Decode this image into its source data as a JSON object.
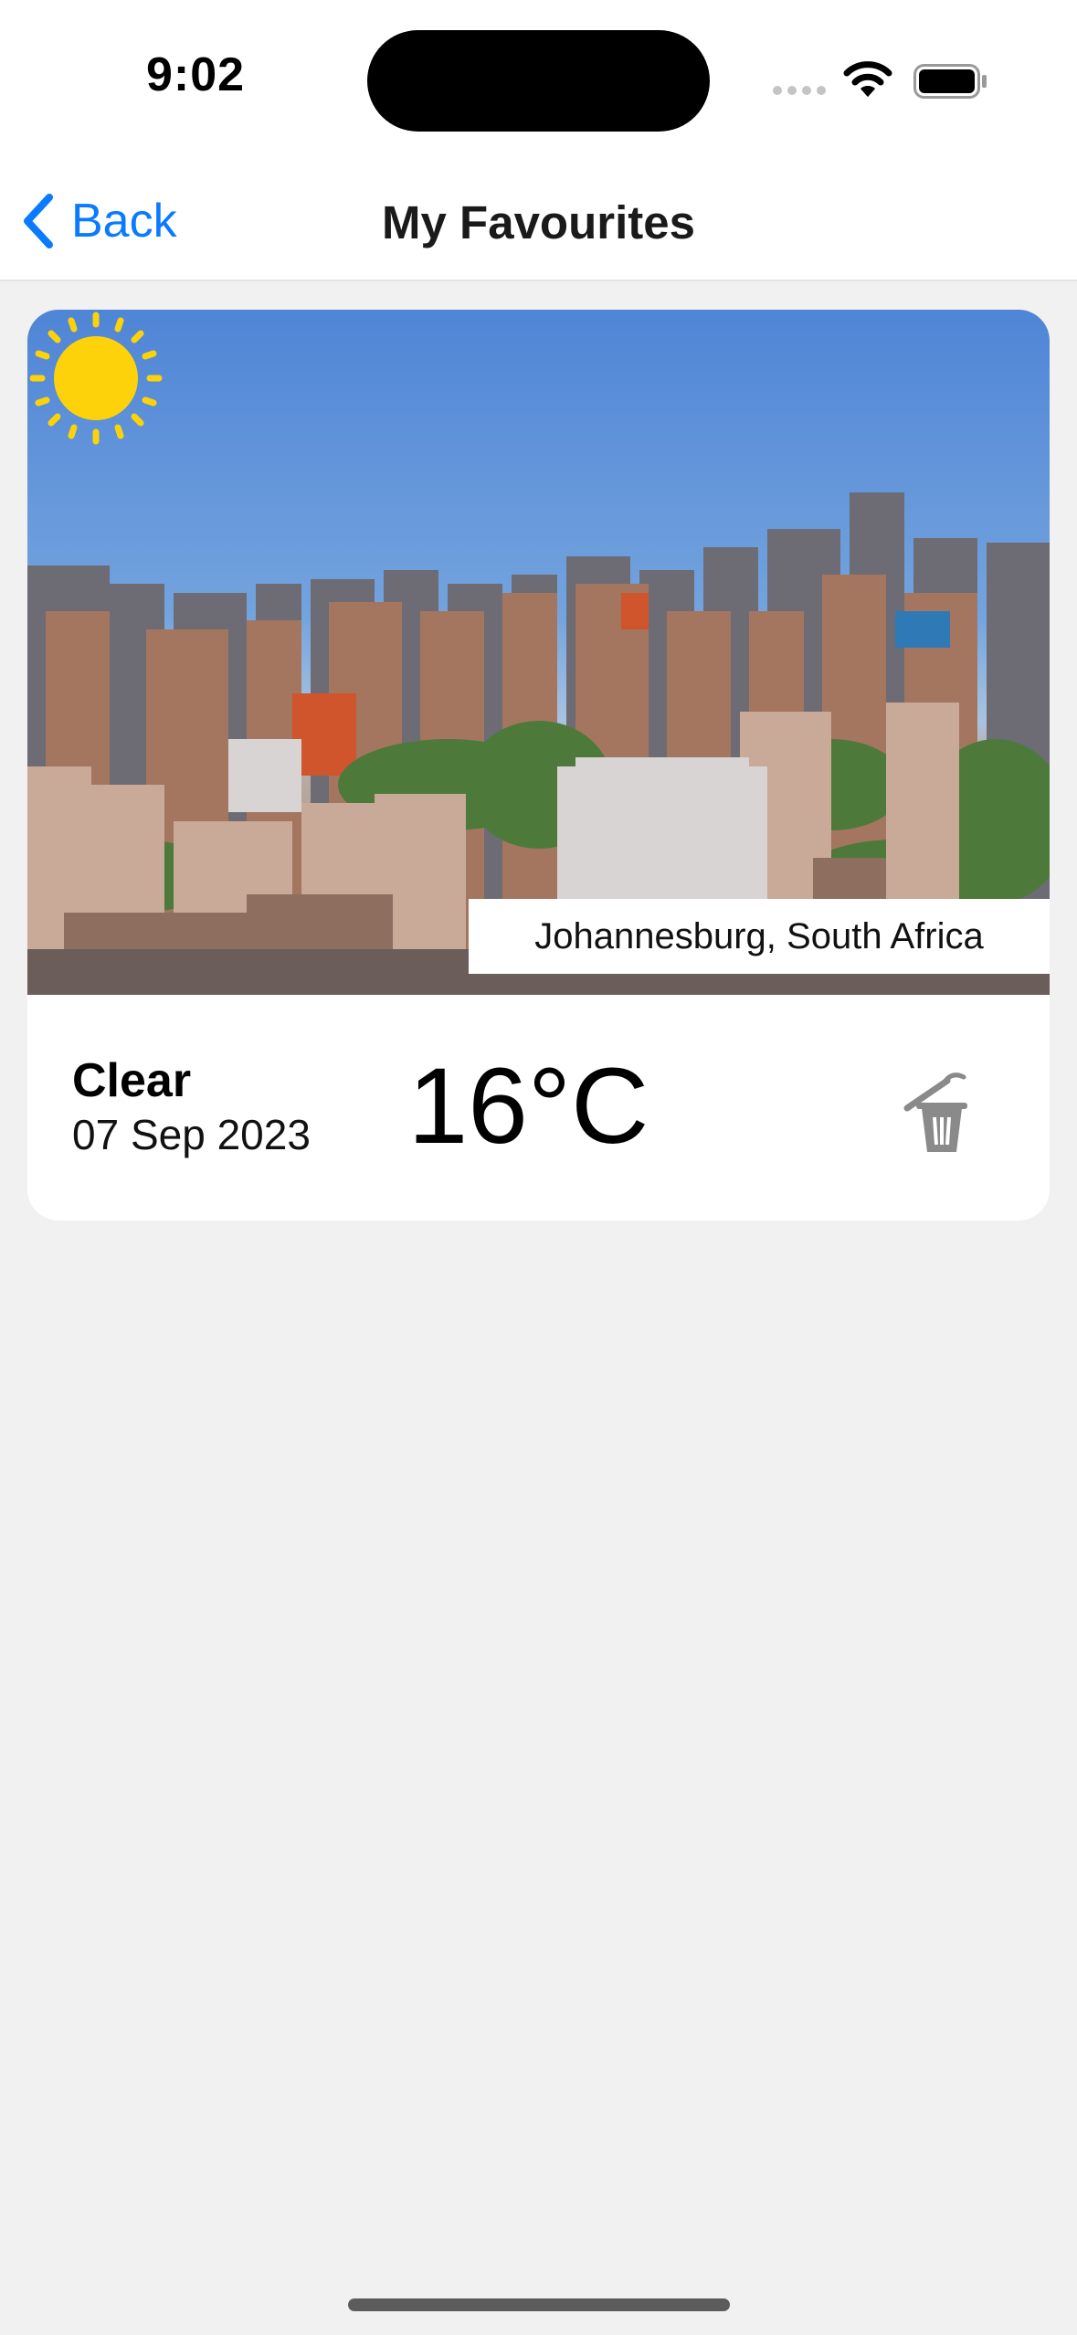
{
  "status_bar": {
    "time": "9:02",
    "icons": [
      "cellular-signal-icon",
      "wifi-icon",
      "battery-icon"
    ]
  },
  "nav": {
    "back_label": "Back",
    "title": "My Favourites",
    "accent_color": "#0a7aff"
  },
  "favourites": [
    {
      "location": "Johannesburg, South Africa",
      "condition": "Clear",
      "date": "07 Sep 2023",
      "temperature": "16°C",
      "weather_icon": "sun-icon",
      "delete_icon": "trash-icon"
    }
  ],
  "colors": {
    "background": "#f1f1f1",
    "card": "#ffffff",
    "sun": "#fdd20a"
  }
}
